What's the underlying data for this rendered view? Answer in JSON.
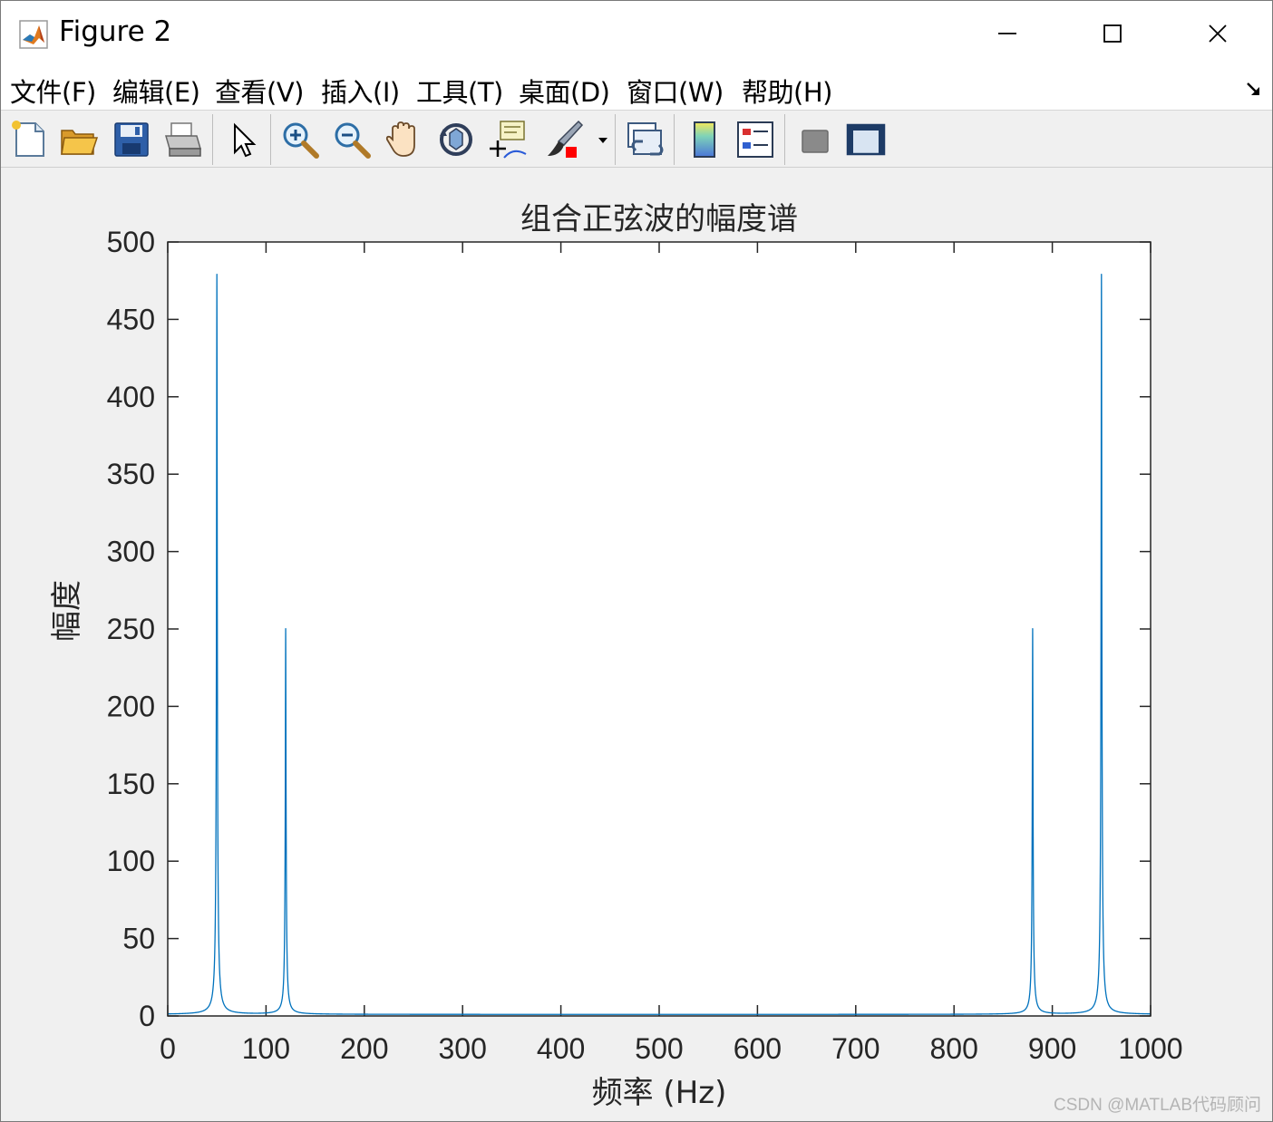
{
  "window": {
    "title": "Figure 2",
    "controls": {
      "minimize": "minimize",
      "maximize": "maximize",
      "close": "close"
    }
  },
  "menubar": {
    "items": [
      {
        "label": "文件(F)"
      },
      {
        "label": "编辑(E)"
      },
      {
        "label": "查看(V)"
      },
      {
        "label": "插入(I)"
      },
      {
        "label": "工具(T)"
      },
      {
        "label": "桌面(D)"
      },
      {
        "label": "窗口(W)"
      },
      {
        "label": "帮助(H)"
      }
    ]
  },
  "toolbar": {
    "buttons": [
      {
        "icon": "new-figure-icon"
      },
      {
        "icon": "open-file-icon"
      },
      {
        "icon": "save-icon"
      },
      {
        "icon": "print-icon"
      },
      {
        "icon": "pointer-icon"
      },
      {
        "icon": "zoom-in-icon"
      },
      {
        "icon": "zoom-out-icon"
      },
      {
        "icon": "pan-hand-icon"
      },
      {
        "icon": "rotate-3d-icon"
      },
      {
        "icon": "data-cursor-icon"
      },
      {
        "icon": "brush-icon"
      },
      {
        "icon": "link-plot-icon"
      },
      {
        "icon": "colorbar-icon"
      },
      {
        "icon": "legend-icon"
      },
      {
        "icon": "hide-plot-tools-icon"
      },
      {
        "icon": "show-plot-tools-icon"
      }
    ]
  },
  "chart_data": {
    "type": "line",
    "title": "组合正弦波的幅度谱",
    "xlabel": "频率 (Hz)",
    "ylabel": "幅度",
    "xlim": [
      0,
      1000
    ],
    "ylim": [
      0,
      500
    ],
    "xticks": [
      0,
      100,
      200,
      300,
      400,
      500,
      600,
      700,
      800,
      900,
      1000
    ],
    "yticks": [
      0,
      50,
      100,
      150,
      200,
      250,
      300,
      350,
      400,
      450,
      500
    ],
    "line_color": "#0072BD",
    "grid": false,
    "peaks": [
      {
        "x": 50,
        "y": 478
      },
      {
        "x": 120,
        "y": 249
      },
      {
        "x": 880,
        "y": 249
      },
      {
        "x": 950,
        "y": 478
      }
    ],
    "baseline": 1
  },
  "watermark": "CSDN @MATLAB代码顾问"
}
